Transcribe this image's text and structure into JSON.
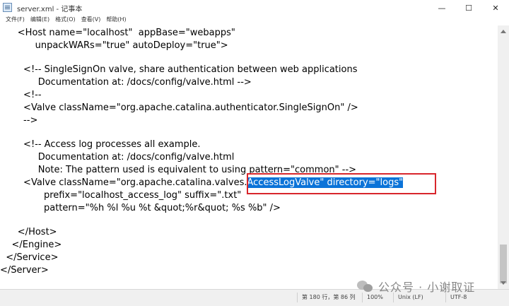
{
  "window": {
    "title": "server.xml - 记事本",
    "minimize_glyph": "—",
    "maximize_glyph": "☐",
    "close_glyph": "✕"
  },
  "menu": [
    "文件(F)",
    "编辑(E)",
    "格式(O)",
    "查看(V)",
    "帮助(H)"
  ],
  "editor": {
    "lines": [
      "      <Host name=\"localhost\"  appBase=\"webapps\"",
      "            unpackWARs=\"true\" autoDeploy=\"true\">",
      "",
      "        <!-- SingleSignOn valve, share authentication between web applications",
      "             Documentation at: /docs/config/valve.html -->",
      "        <!--",
      "        <Valve className=\"org.apache.catalina.authenticator.SingleSignOn\" />",
      "        -->",
      "",
      "        <!-- Access log processes all example.",
      "             Documentation at: /docs/config/valve.html",
      "             Note: The pattern used is equivalent to using pattern=\"common\" -->",
      "        <Valve className=\"org.apache.catalina.valves.",
      "               prefix=\"localhost_access_log\" suffix=\".txt\"",
      "               pattern=\"%h %l %u %t &quot;%r&quot; %s %b\" />",
      "",
      "      </Host>",
      "    </Engine>",
      "  </Service>",
      "</Server>"
    ],
    "selected_text": "AccessLogValve\" directory=\"logs\""
  },
  "status": {
    "position": "第 180 行，第 86 列",
    "zoom": "100%",
    "line_ending": "Unix (LF)",
    "encoding": "UTF-8"
  },
  "watermark": {
    "text": "公众号 · 小谢取证"
  }
}
